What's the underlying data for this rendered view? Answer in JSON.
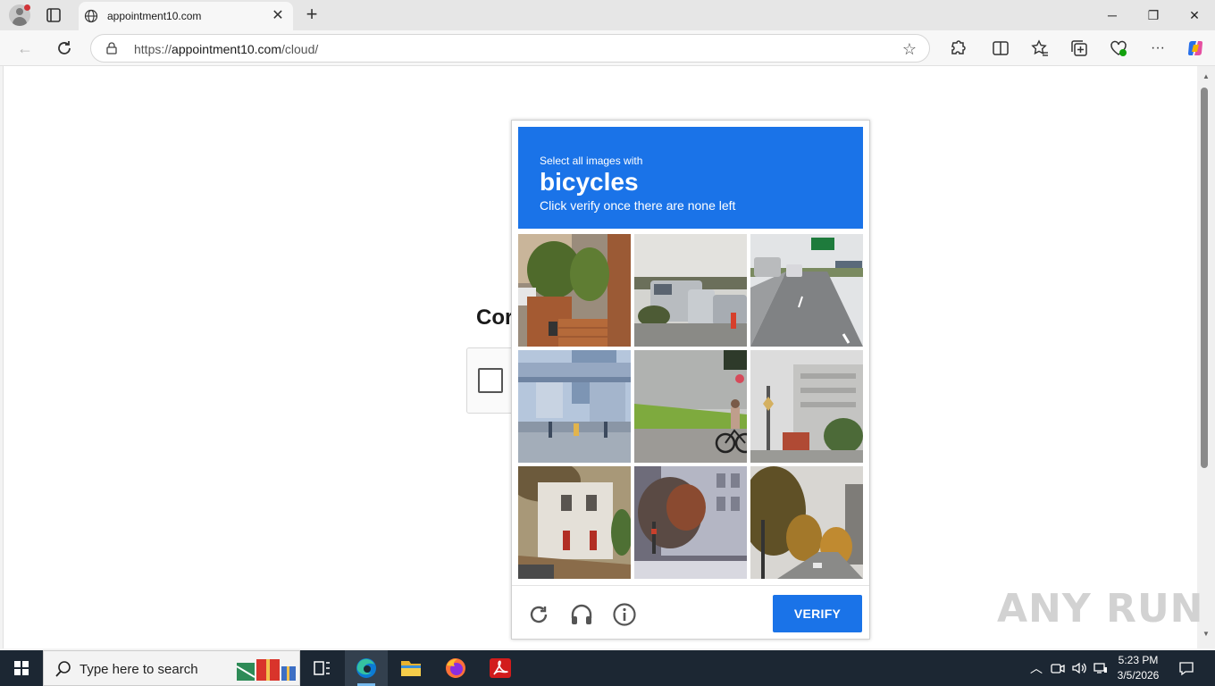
{
  "browser": {
    "tab_title": "appointment10.com",
    "url_prefix": "https://",
    "url_host": "appointment10.com",
    "url_path": "/cloud/"
  },
  "page": {
    "heading_partial": "Cor"
  },
  "captcha": {
    "instruction_line1": "Select all images with",
    "target": "bicycles",
    "instruction_line3": "Click verify once there are none left",
    "verify_label": "VERIFY",
    "header_color": "#1a73e8",
    "tiles": [
      {
        "scene": "brick-gate-with-plants"
      },
      {
        "scene": "parked-vans"
      },
      {
        "scene": "highway-with-sign"
      },
      {
        "scene": "city-plaza-overpass"
      },
      {
        "scene": "cyclist-on-sidewalk"
      },
      {
        "scene": "gray-building-traffic-light"
      },
      {
        "scene": "white-house-red-doors"
      },
      {
        "scene": "building-with-trees"
      },
      {
        "scene": "autumn-street"
      }
    ],
    "footer_icons": [
      "reload-icon",
      "headphones-icon",
      "info-icon"
    ]
  },
  "watermark": "ANY RUN",
  "taskbar": {
    "search_placeholder": "Type here to search",
    "time": "5:23 PM",
    "date": "3/5/2026"
  }
}
